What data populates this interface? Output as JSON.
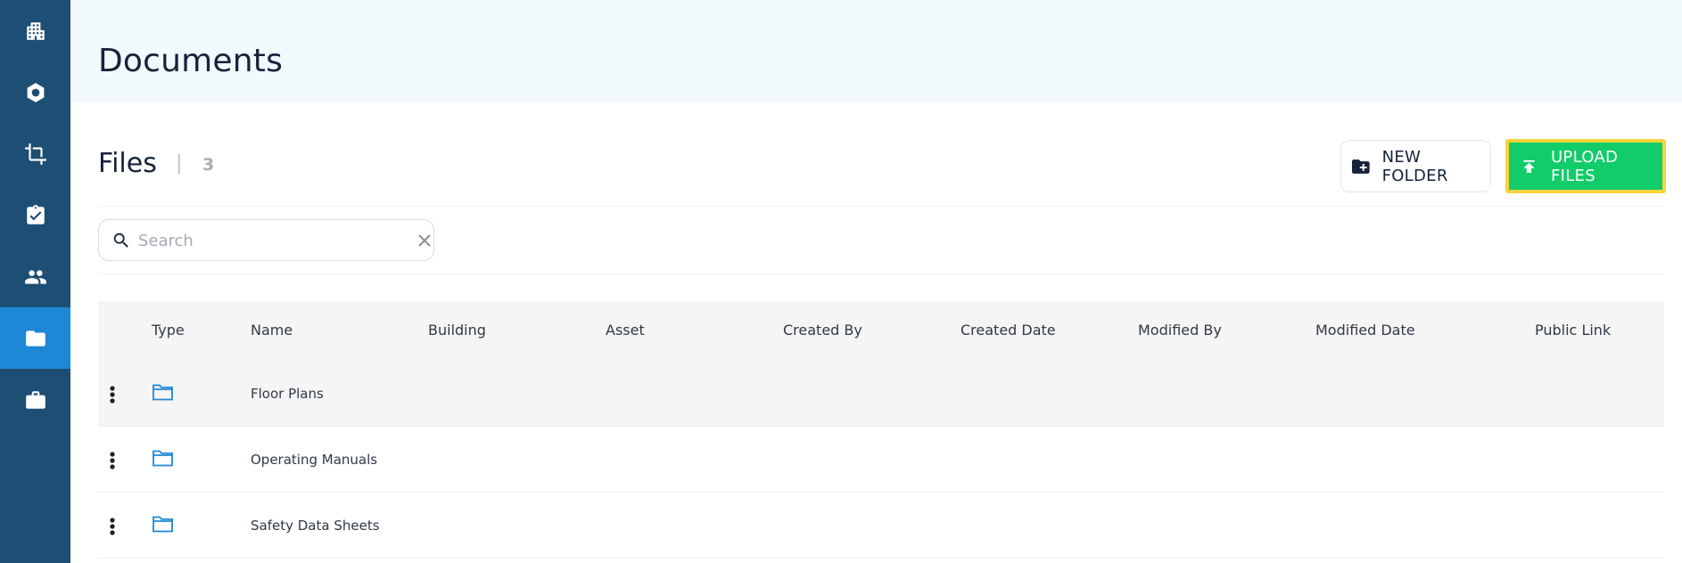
{
  "sidebar": {
    "items": [
      {
        "icon": "building-icon",
        "active": false
      },
      {
        "icon": "hexagon-icon",
        "active": false
      },
      {
        "icon": "crop-icon",
        "active": false
      },
      {
        "icon": "clipboard-check-icon",
        "active": false
      },
      {
        "icon": "people-icon",
        "active": false
      },
      {
        "icon": "folder-icon",
        "active": true
      },
      {
        "icon": "briefcase-icon",
        "active": false
      }
    ],
    "colors": {
      "background": "#1d4e73",
      "active": "#1e88d6"
    }
  },
  "header": {
    "title": "Documents"
  },
  "files": {
    "title": "Files",
    "separator": "|",
    "count": "3",
    "new_folder_label": "NEW FOLDER",
    "upload_label": "UPLOAD FILES",
    "new_folder_icon": "folder-plus-icon",
    "upload_icon": "upload-icon"
  },
  "search": {
    "placeholder": "Search",
    "value": ""
  },
  "table": {
    "columns": [
      "Type",
      "Name",
      "Building",
      "Asset",
      "Created By",
      "Created Date",
      "Modified By",
      "Modified Date",
      "Public Link"
    ],
    "rows": [
      {
        "type": "folder",
        "name": "Floor Plans"
      },
      {
        "type": "folder",
        "name": "Operating Manuals"
      },
      {
        "type": "folder",
        "name": "Safety Data Sheets"
      }
    ]
  },
  "colors": {
    "accent": "#1e88d6",
    "upload_button": "#12cc6a",
    "upload_highlight": "#f8d33a",
    "header_bg": "#f1f9fd"
  }
}
